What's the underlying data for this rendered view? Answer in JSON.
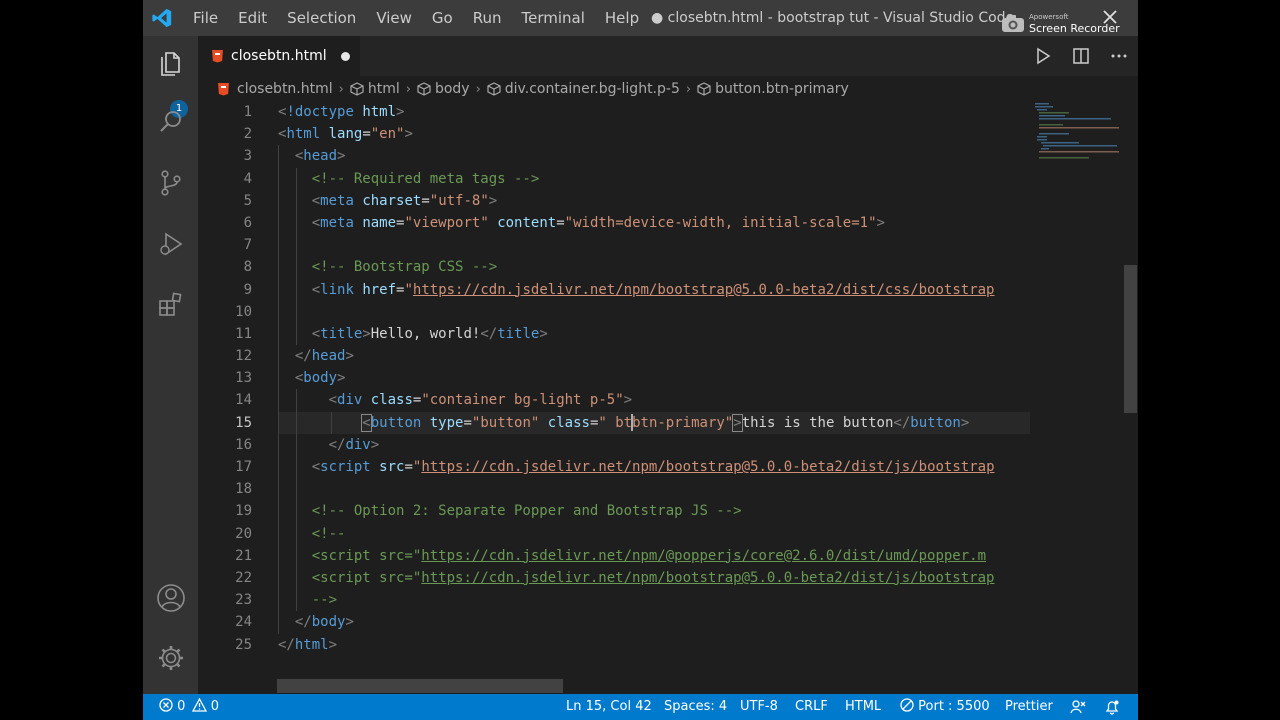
{
  "titlebar": {
    "menu": [
      "File",
      "Edit",
      "Selection",
      "View",
      "Go",
      "Run",
      "Terminal",
      "Help"
    ],
    "window_title": "● closebtn.html - bootstrap tut - Visual Studio Code",
    "recorder_brand": "Apowersoft",
    "recorder_name": "Screen Recorder"
  },
  "activity_bar": {
    "items": [
      "explorer-icon",
      "search-icon",
      "source-control-icon",
      "run-debug-icon",
      "extensions-icon"
    ],
    "bottom": [
      "account-icon",
      "gear-icon"
    ],
    "explorer_badge": "1"
  },
  "tab": {
    "label": "closebtn.html",
    "modified": true
  },
  "breadcrumb": {
    "file": "closebtn.html",
    "items": [
      "html",
      "body",
      "div.container.bg-light.p-5",
      "button.btn-primary"
    ]
  },
  "editor": {
    "active_line": 15,
    "lines": [
      {
        "n": "1"
      },
      {
        "n": "2"
      },
      {
        "n": "3"
      },
      {
        "n": "4"
      },
      {
        "n": "5"
      },
      {
        "n": "6"
      },
      {
        "n": "7"
      },
      {
        "n": "8"
      },
      {
        "n": "9"
      },
      {
        "n": "10"
      },
      {
        "n": "11"
      },
      {
        "n": "12"
      },
      {
        "n": "13"
      },
      {
        "n": "14"
      },
      {
        "n": "15"
      },
      {
        "n": "16"
      },
      {
        "n": "17"
      },
      {
        "n": "18"
      },
      {
        "n": "19"
      },
      {
        "n": "20"
      },
      {
        "n": "21"
      },
      {
        "n": "22"
      },
      {
        "n": "23"
      },
      {
        "n": "24"
      },
      {
        "n": "25"
      }
    ],
    "tokens": {
      "l1_tag": "!doctype",
      "l1_attr": "html",
      "l2_tag": "html",
      "l2_attr": "lang",
      "l2_val": "\"en\"",
      "l3_tag": "head",
      "l4_comment": "<!-- Required meta tags -->",
      "l5_tag": "meta",
      "l5_attr": "charset",
      "l5_val": "\"utf-8\"",
      "l6_tag": "meta",
      "l6_attr1": "name",
      "l6_val1": "\"viewport\"",
      "l6_attr2": "content",
      "l6_val2": "\"width=device-width, initial-scale=1\"",
      "l8_comment": "<!-- Bootstrap CSS -->",
      "l9_tag": "link",
      "l9_attr": "href",
      "l9_url": "https://cdn.jsdelivr.net/npm/bootstrap@5.0.0-beta2/dist/css/bootstrap",
      "l11_tag": "title",
      "l11_text": "Hello, world!",
      "l12_tag": "head",
      "l13_tag": "body",
      "l14_tag": "div",
      "l14_attr": "class",
      "l14_val": "\"container bg-light p-5\"",
      "l15_tag": "button",
      "l15_attr1": "type",
      "l15_val1": "\"button\"",
      "l15_attr2": "class",
      "l15_val2a": "\" bt",
      "l15_val2b": "btn-primary\"",
      "l15_text": "this is the button",
      "l16_tag": "div",
      "l17_tag": "script",
      "l17_attr": "src",
      "l17_url": "https://cdn.jsdelivr.net/npm/bootstrap@5.0.0-beta2/dist/js/bootstrap",
      "l19_comment": "<!-- Option 2: Separate Popper and Bootstrap JS -->",
      "l20_comment": "<!--",
      "l21_pre": "<script src=\"",
      "l21_url": "https://cdn.jsdelivr.net/npm/@popperjs/core@2.6.0/dist/umd/popper.m",
      "l22_pre": "<script src=\"",
      "l22_url": "https://cdn.jsdelivr.net/npm/bootstrap@5.0.0-beta2/dist/js/bootstrap",
      "l23_comment": "-->",
      "l24_tag": "body",
      "l25_tag": "html"
    }
  },
  "statusbar": {
    "errors": "0",
    "warnings": "0",
    "position": "Ln 15, Col 42",
    "spaces": "Spaces: 4",
    "encoding": "UTF-8",
    "eol": "CRLF",
    "language": "HTML",
    "port": "Port : 5500",
    "formatter": "Prettier"
  },
  "colors": {
    "status_bar": "#007acc",
    "editor_bg": "#1e1e1e",
    "tag": "#569cd6",
    "attr": "#9cdcfe",
    "string": "#ce9178",
    "comment": "#6a9955"
  }
}
